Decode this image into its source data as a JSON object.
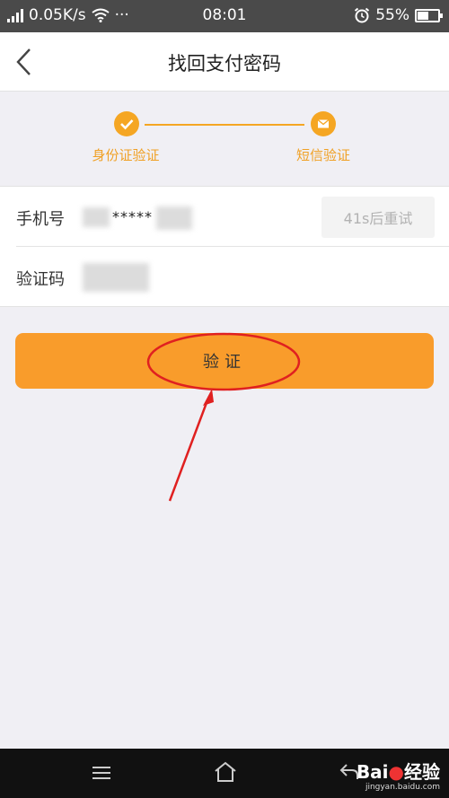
{
  "status_bar": {
    "speed": "0.05K/s",
    "more": "···",
    "time": "08:01",
    "battery": "55%",
    "battery_level": 0.55
  },
  "header": {
    "title": "找回支付密码"
  },
  "steps": [
    {
      "label": "身份证验证",
      "icon": "check-icon"
    },
    {
      "label": "短信验证",
      "icon": "mail-icon"
    }
  ],
  "form": {
    "phone_label": "手机号",
    "phone_value": "*****",
    "retry_label": "41s后重试",
    "code_label": "验证码"
  },
  "verify_button": {
    "label": "验证"
  },
  "watermark": {
    "brand": "Bai",
    "brand_suffix": "经验",
    "domain": "jingyan.baidu.com"
  },
  "colors": {
    "accent": "#f5a623",
    "button": "#f99c2b",
    "annotation": "#e02020"
  }
}
